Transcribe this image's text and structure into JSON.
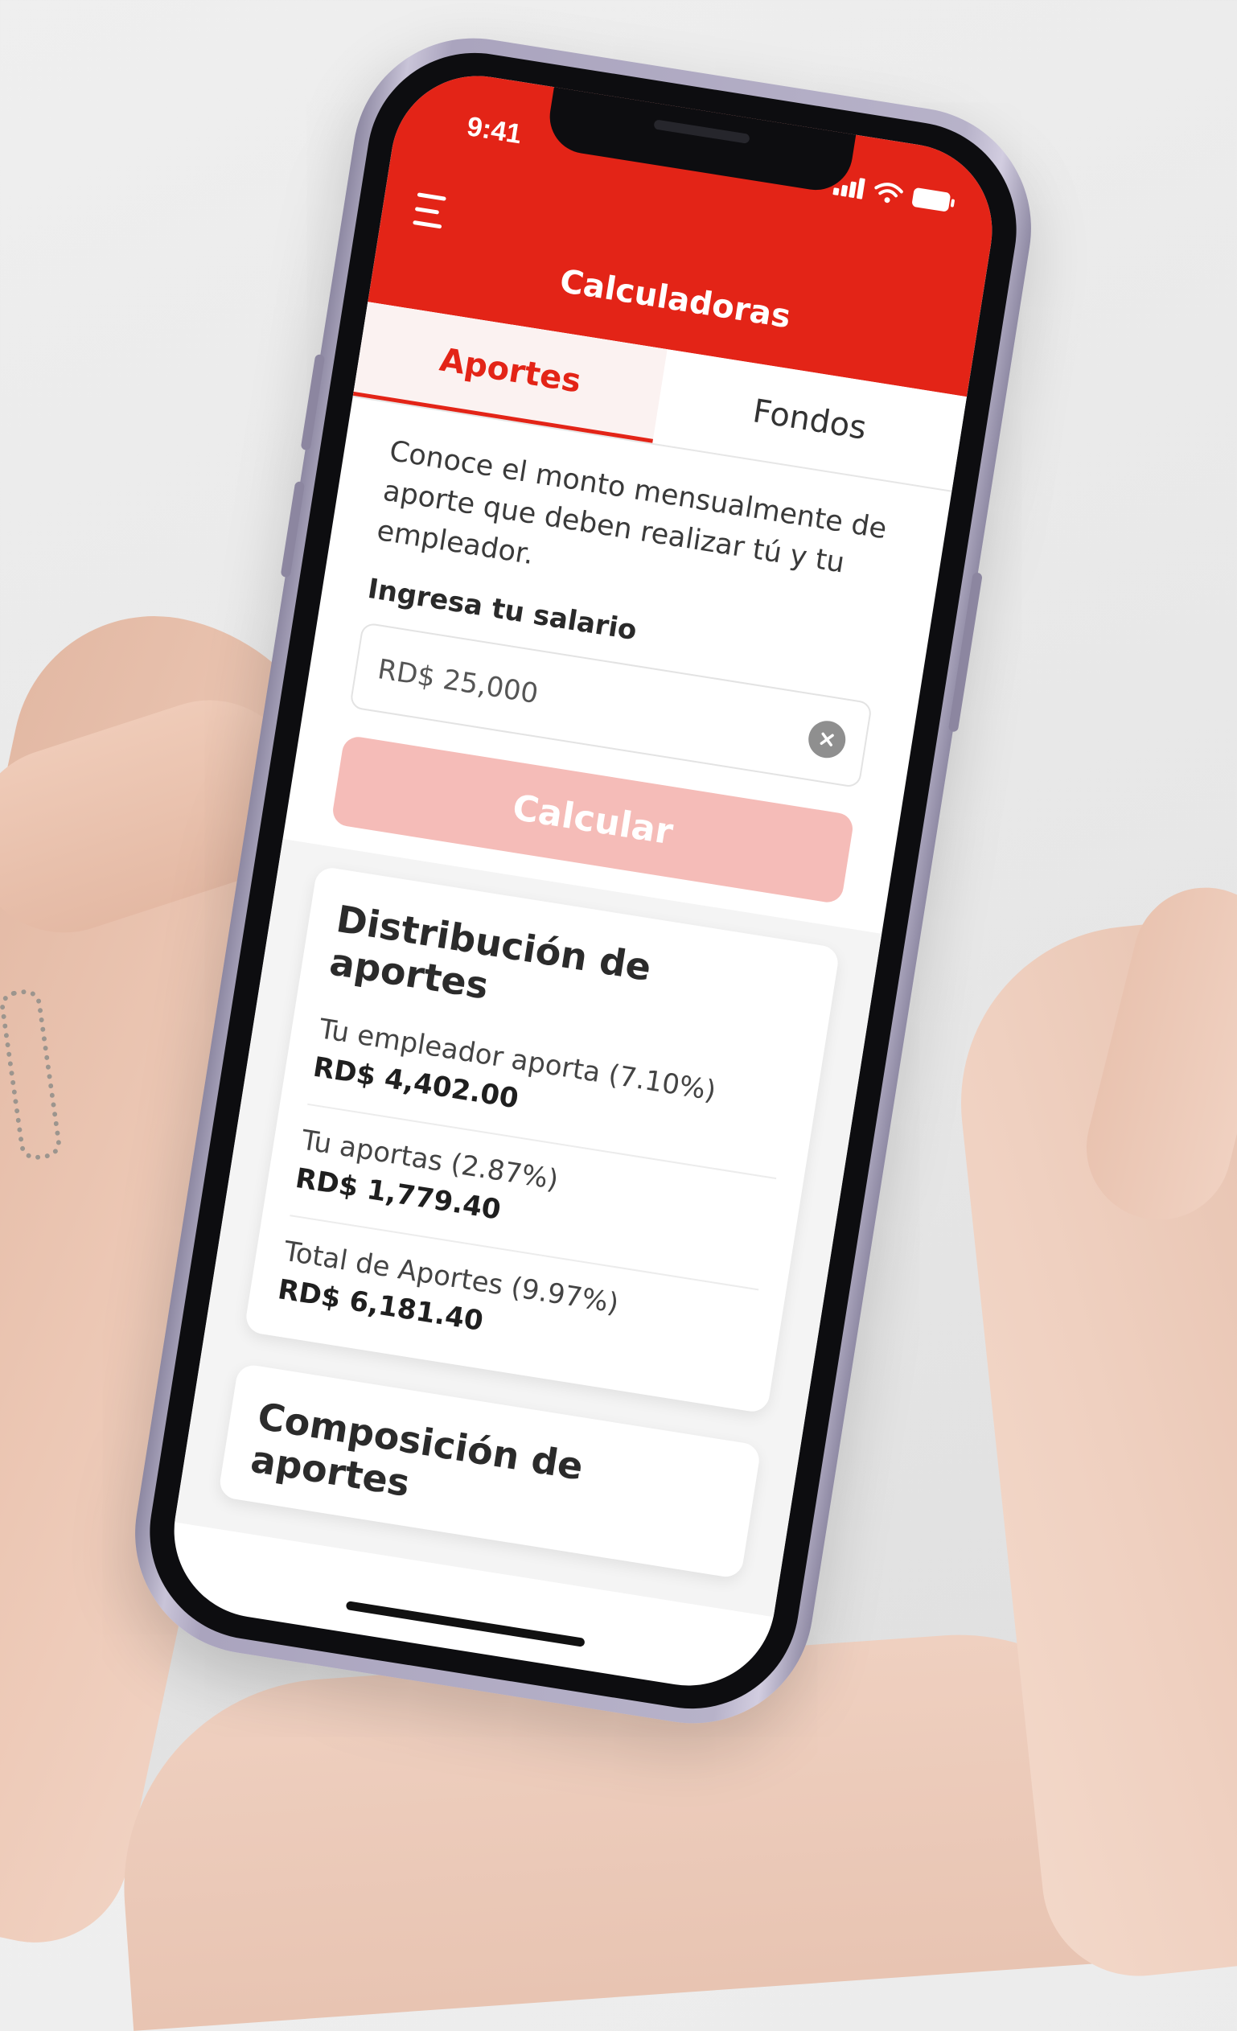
{
  "status_bar": {
    "time": "9:41"
  },
  "header": {
    "title": "Calculadoras",
    "accent_color": "#e32417"
  },
  "tabs": [
    {
      "label": "Aportes",
      "active": true
    },
    {
      "label": "Fondos",
      "active": false
    }
  ],
  "aportes": {
    "intro": "Conoce el monto mensualmente de aporte que deben realizar tú y tu empleador.",
    "salary_label": "Ingresa tu salario",
    "salary_value": "RD$ 25,000",
    "calculate_label": "Calcular"
  },
  "distribucion": {
    "title": "Distribución de aportes",
    "items": [
      {
        "label": "Tu empleador aporta (7.10%)",
        "value": "RD$ 4,402.00"
      },
      {
        "label": "Tu aportas (2.87%)",
        "value": "RD$ 1,779.40"
      },
      {
        "label": "Total de Aportes (9.97%)",
        "value": "RD$ 6,181.40"
      }
    ]
  },
  "composicion": {
    "title": "Composición de aportes"
  },
  "icons": {
    "menu": "hamburger-menu-icon",
    "signal": "signal-icon",
    "wifi": "wifi-icon",
    "battery": "battery-icon",
    "clear": "clear-icon"
  }
}
